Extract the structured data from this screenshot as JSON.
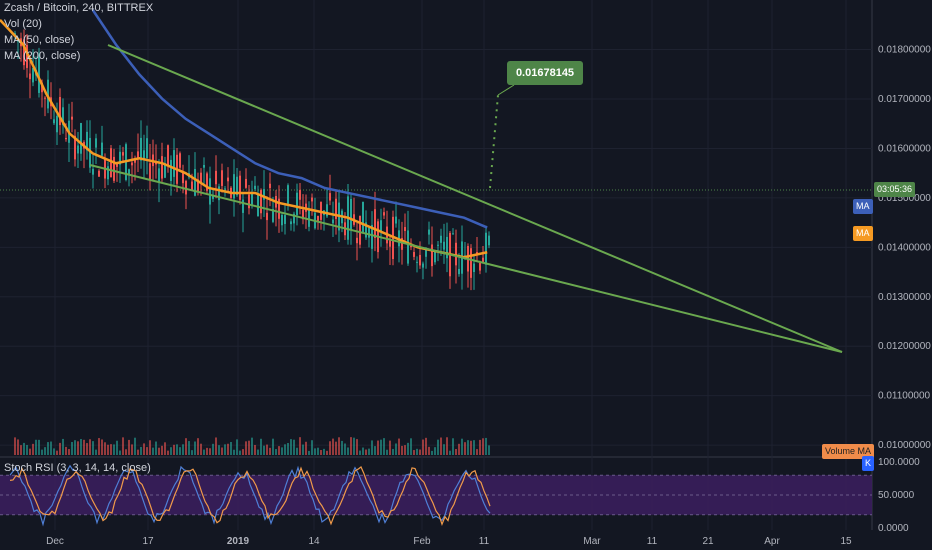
{
  "header": {
    "symbol": "Zcash / Bitcoin, 240, BITTREX",
    "vol": "Vol (20)",
    "ma50": "MA (50, close)",
    "ma200": "MA (200, close)",
    "stoch": "Stoch RSI (3, 3, 14, 14, close)"
  },
  "price_axis": {
    "ticks": [
      "0.01800000",
      "0.01700000",
      "0.01600000",
      "0.01500000",
      "0.01400000",
      "0.01300000",
      "0.01200000",
      "0.01100000",
      "0.01000000"
    ],
    "current_price_tag": "03:05:36",
    "ma_tag_blue": "MA",
    "ma_tag_orange": "MA",
    "volume_ma_tag": "Volume MA"
  },
  "stoch_axis": {
    "ticks": [
      "100.0000",
      "50.0000",
      "0.0000"
    ],
    "k_tag": "K"
  },
  "time_axis": {
    "labels": [
      "Dec",
      "17",
      "2019",
      "14",
      "Feb",
      "11",
      "Mar",
      "11",
      "21",
      "Apr",
      "15"
    ]
  },
  "callout": {
    "label": "0.01678145"
  },
  "colors": {
    "background": "#131722",
    "ma50": "#f59a23",
    "ma200": "#3c5fb8",
    "trendline": "#6aa84f",
    "stoch_band": "#3a1e5c",
    "candle_up": "#26a69a",
    "candle_down": "#ef5350"
  },
  "chart_data": {
    "type": "line",
    "title": "Zcash / Bitcoin, 240, BITTREX",
    "ylim": [
      0.0098,
      0.0188
    ],
    "x_axis_labels": [
      "Dec",
      "17",
      "2019",
      "14",
      "Feb",
      "11",
      "Mar",
      "11",
      "21",
      "Apr",
      "15"
    ],
    "series": [
      {
        "name": "MA (50, close)",
        "x_index": [
          0,
          2,
          4,
          6,
          8,
          10,
          12,
          14,
          16,
          18,
          20,
          22,
          24,
          26,
          28,
          30,
          32,
          34,
          36,
          38,
          40,
          42
        ],
        "values": [
          0.0186,
          0.0181,
          0.0171,
          0.0163,
          0.0159,
          0.0157,
          0.0158,
          0.0157,
          0.0155,
          0.0152,
          0.0151,
          0.0151,
          0.0149,
          0.0148,
          0.0147,
          0.0146,
          0.0144,
          0.0142,
          0.014,
          0.0139,
          0.0138,
          0.0139
        ]
      },
      {
        "name": "MA (200, close)",
        "x_index": [
          8,
          10,
          12,
          14,
          16,
          18,
          20,
          22,
          24,
          26,
          28,
          30,
          32,
          34,
          36,
          38,
          40,
          42
        ],
        "values": [
          0.0188,
          0.0181,
          0.0175,
          0.017,
          0.0166,
          0.0163,
          0.016,
          0.0157,
          0.0155,
          0.0154,
          0.0152,
          0.0151,
          0.015,
          0.0149,
          0.0148,
          0.0147,
          0.0146,
          0.0144
        ]
      }
    ],
    "annotations": [
      "0.01678145"
    ]
  }
}
